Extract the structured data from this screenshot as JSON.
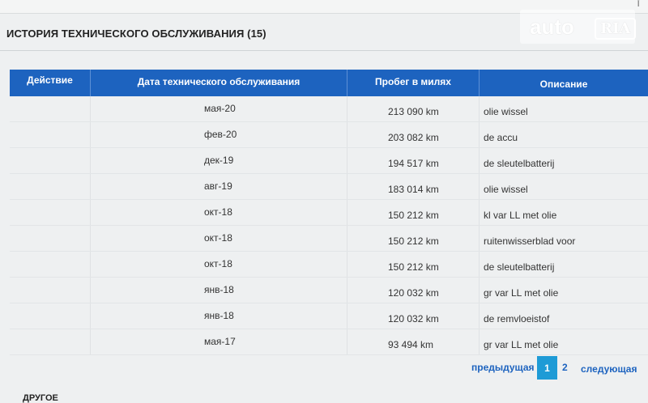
{
  "logo": {
    "text": "auto",
    "badge": "RIA"
  },
  "section": {
    "title": "ИСТОРИЯ ТЕХНИЧЕСКОГО ОБСЛУЖИВАНИЯ (15)"
  },
  "table": {
    "columns": [
      "Действие",
      "Дата технического обслуживания",
      "Пробег в милях",
      "Описание"
    ],
    "rows": [
      {
        "action": "",
        "date": "мая-20",
        "mileage": "213 090 km",
        "description": "olie wissel"
      },
      {
        "action": "",
        "date": "фев-20",
        "mileage": "203 082 km",
        "description": "de accu"
      },
      {
        "action": "",
        "date": "дек-19",
        "mileage": "194 517 km",
        "description": "de sleutelbatterij"
      },
      {
        "action": "",
        "date": "авг-19",
        "mileage": "183 014 km",
        "description": "olie wissel"
      },
      {
        "action": "",
        "date": "окт-18",
        "mileage": "150 212 km",
        "description": "kl var LL met olie"
      },
      {
        "action": "",
        "date": "окт-18",
        "mileage": "150 212 km",
        "description": "ruitenwisserblad voor"
      },
      {
        "action": "",
        "date": "окт-18",
        "mileage": "150 212 km",
        "description": "de sleutelbatterij"
      },
      {
        "action": "",
        "date": "янв-18",
        "mileage": "120 032 km",
        "description": "gr var LL met olie"
      },
      {
        "action": "",
        "date": "янв-18",
        "mileage": "120 032 km",
        "description": "de remvloeistof"
      },
      {
        "action": "",
        "date": "мая-17",
        "mileage": "93 494 km",
        "description": "gr var LL met olie"
      }
    ]
  },
  "pagination": {
    "prev": "предыдущая",
    "pages": [
      "1",
      "2"
    ],
    "current": "1",
    "next": "следующая"
  },
  "other": {
    "heading": "ДРУГОЕ"
  },
  "colors": {
    "header_blue": "#1d63bf",
    "active_page": "#1e9bd6",
    "link": "#1d63bf"
  }
}
